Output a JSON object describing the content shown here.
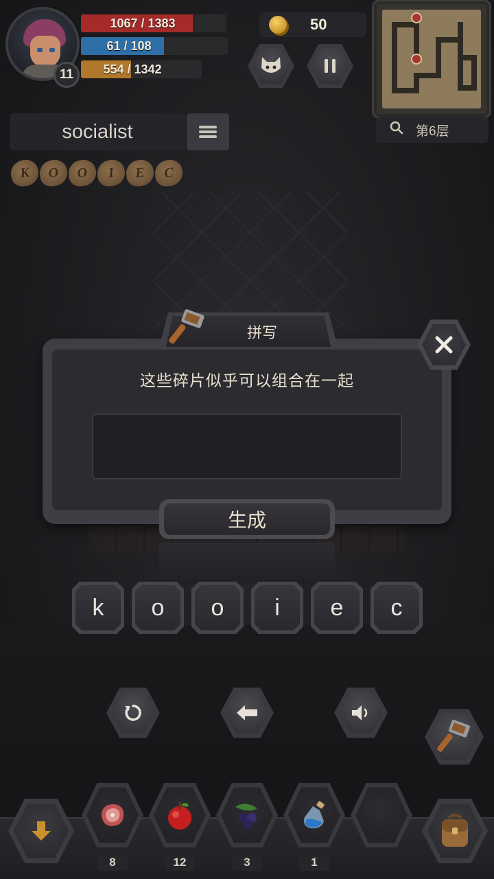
{
  "player": {
    "level": "11",
    "hp": {
      "current": "1067",
      "max": "1383",
      "separator": " / ",
      "fraction": 0.771,
      "color": "#a62a2a"
    },
    "mp": {
      "current": "61",
      "max": "108",
      "separator": " / ",
      "fraction": 0.565,
      "color": "#2e6fa8"
    },
    "xp": {
      "current": "554",
      "max": "1342",
      "separator": " / ",
      "fraction": 0.413,
      "color": "#b0782a"
    }
  },
  "coins": "50",
  "floor": "第6层",
  "word_panel": {
    "word": "socialist",
    "fragments": [
      "K",
      "O",
      "O",
      "I",
      "E",
      "C"
    ]
  },
  "dialog": {
    "title": "拼写",
    "message": "这些碎片似乎可以组合在一起",
    "input_value": "",
    "generate_label": "生成"
  },
  "letters": [
    "k",
    "o",
    "o",
    "i",
    "e",
    "c"
  ],
  "inventory": [
    {
      "item": "meat-icon",
      "count": "8"
    },
    {
      "item": "apple-icon",
      "count": "12"
    },
    {
      "item": "berries-icon",
      "count": "3"
    },
    {
      "item": "potion-icon",
      "count": "1"
    },
    {
      "item": "empty-slot",
      "count": ""
    }
  ],
  "icons": {
    "reset": "reset-icon",
    "backspace": "backspace-arrow-icon",
    "sound": "speaker-icon",
    "pet": "pet-face-icon",
    "pause": "pause-icon",
    "close": "close-icon",
    "craft": "hammer-icon",
    "descend": "down-arrow-icon",
    "bag": "backpack-icon"
  }
}
